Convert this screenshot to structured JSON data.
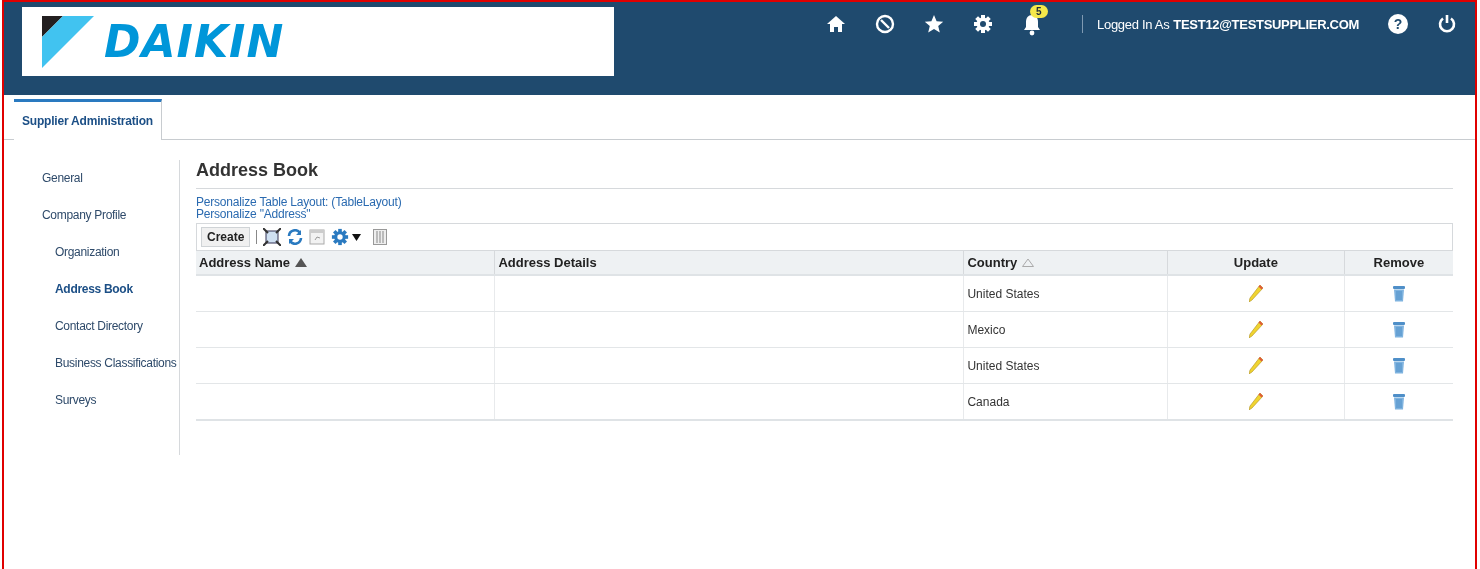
{
  "header": {
    "logo": "DAIKIN",
    "notifications": {
      "count": "5"
    },
    "login_label": "Logged In As",
    "user": "TEST12@TESTSUPPLIER.COM",
    "help": "?"
  },
  "tabs": [
    {
      "label": "Supplier Administration",
      "selected": true
    }
  ],
  "sidebar": {
    "items": [
      {
        "label": "General",
        "selected": false
      },
      {
        "label": "Company Profile",
        "selected": false,
        "children": [
          {
            "label": "Organization",
            "selected": false
          },
          {
            "label": "Address Book",
            "selected": true
          },
          {
            "label": "Contact Directory",
            "selected": false
          },
          {
            "label": "Business Classifications",
            "selected": false
          },
          {
            "label": "Surveys",
            "selected": false
          }
        ]
      }
    ]
  },
  "page_title": "Address Book",
  "links": [
    "Personalize Table Layout: (TableLayout)",
    "Personalize \"Address\""
  ],
  "toolbar": {
    "create_button": "Create"
  },
  "table": {
    "columns": [
      {
        "label": "Address Name",
        "sorted": true
      },
      {
        "label": "Address Details"
      },
      {
        "label": "Country",
        "sorted": false
      },
      {
        "label": "Update"
      },
      {
        "label": "Remove"
      }
    ],
    "rows": [
      {
        "country": "United States"
      },
      {
        "country": "Mexico"
      },
      {
        "country": "United States"
      },
      {
        "country": "Canada"
      }
    ]
  }
}
